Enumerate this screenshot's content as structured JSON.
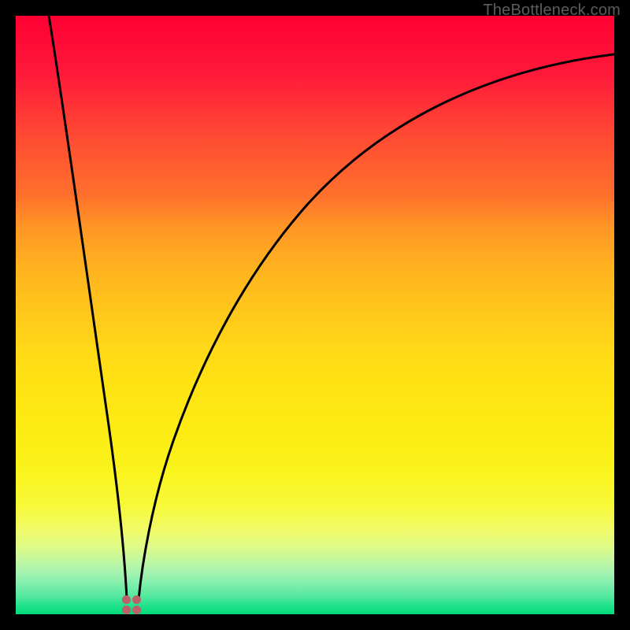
{
  "attribution": "TheBottleneck.com",
  "marker": {
    "x_fraction": 0.193,
    "color": "#bd6169"
  },
  "chart_data": {
    "type": "line",
    "title": "",
    "xlabel": "",
    "ylabel": "",
    "xlim": [
      0,
      1
    ],
    "ylim": [
      0,
      1
    ],
    "series": [
      {
        "name": "left-curve",
        "x": [
          0.055,
          0.07,
          0.085,
          0.1,
          0.115,
          0.13,
          0.145,
          0.16,
          0.175,
          0.185
        ],
        "values": [
          1.0,
          0.88,
          0.76,
          0.64,
          0.52,
          0.4,
          0.29,
          0.18,
          0.08,
          0.025
        ]
      },
      {
        "name": "right-curve",
        "x": [
          0.205,
          0.22,
          0.25,
          0.29,
          0.34,
          0.4,
          0.47,
          0.55,
          0.63,
          0.72,
          0.82,
          0.92,
          1.0
        ],
        "values": [
          0.025,
          0.09,
          0.2,
          0.32,
          0.44,
          0.55,
          0.645,
          0.725,
          0.79,
          0.845,
          0.89,
          0.92,
          0.935
        ]
      }
    ],
    "background_gradient": {
      "top": "#ff0033",
      "mid": "#ffe313",
      "bottom": "#00db7a"
    },
    "marker_points_x": [
      0.186,
      0.2
    ],
    "marker_color": "#bd6169"
  }
}
